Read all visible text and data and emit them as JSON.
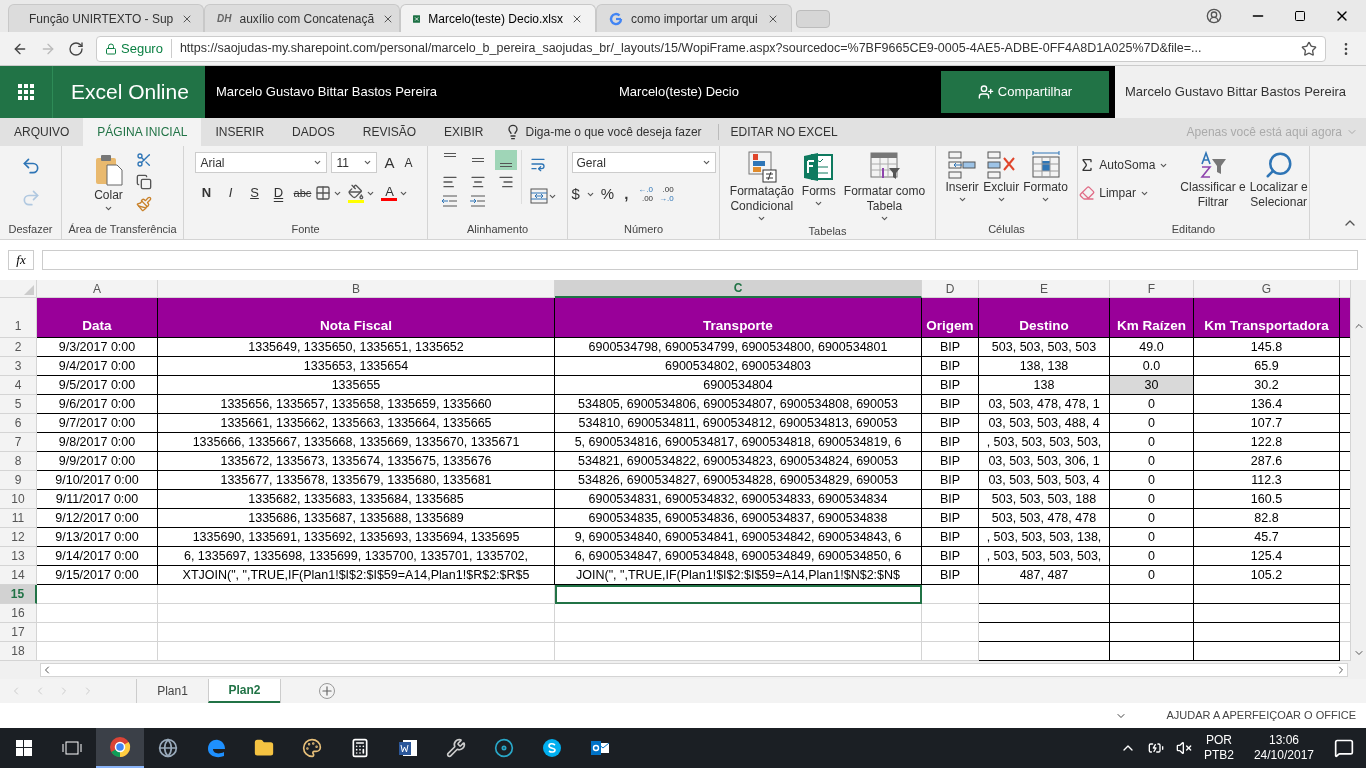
{
  "browser": {
    "tabs": [
      {
        "title": "Função UNIRTEXTO - Sup",
        "kind": "office",
        "selected": false
      },
      {
        "title": "auxílio com Concatenaçã",
        "kind": "dh",
        "icon_text": "DH",
        "selected": false
      },
      {
        "title": "Marcelo(teste) Decio.xlsx",
        "kind": "excel",
        "selected": true
      },
      {
        "title": "como importar um arqui",
        "kind": "google",
        "selected": false
      }
    ],
    "secure_label": "Seguro",
    "url": "https://saojudas-my.sharepoint.com/personal/marcelo_b_pereira_saojudas_br/_layouts/15/WopiFrame.aspx?sourcedoc=%7BF9665CE9-0005-4AE5-ADBE-0FF4A8D1A025%7D&file=..."
  },
  "app_bar": {
    "app_name": "Excel Online",
    "owner": "Marcelo Gustavo Bittar Bastos Pereira",
    "document": "Marcelo(teste) Decio",
    "share": "Compartilhar",
    "user": "Marcelo Gustavo Bittar Bastos Pereira"
  },
  "ribbon_tabs": [
    {
      "label": "ARQUIVO",
      "selected": false
    },
    {
      "label": "PÁGINA INICIAL",
      "selected": true
    },
    {
      "label": "INSERIR",
      "selected": false
    },
    {
      "label": "DADOS",
      "selected": false
    },
    {
      "label": "REVISÃO",
      "selected": false
    },
    {
      "label": "EXIBIR",
      "selected": false
    }
  ],
  "tell_me": "Diga-me o que você deseja fazer",
  "edit_in_excel": "EDITAR NO EXCEL",
  "presence": "Apenas você está aqui agora",
  "ribbon": {
    "undo_label": "Desfazer",
    "clipboard": {
      "paste": "Colar",
      "label": "Área de Transferência"
    },
    "font": {
      "name": "Arial",
      "size": "11",
      "grow": "A",
      "shrink": "A",
      "styles": [
        "N",
        "I",
        "S",
        "D",
        "abc"
      ],
      "color_letter": "A",
      "label": "Fonte"
    },
    "alignment": {
      "vertical": [
        {
          "selected": false
        },
        {
          "selected": false
        },
        {
          "selected": true
        }
      ],
      "label": "Alinhamento"
    },
    "number": {
      "format": "Geral",
      "currency": "$",
      "percent": "%",
      "comma": ",",
      "increase_decimal": {
        "arrow": "←",
        "top": ".0",
        "bottom": ".00"
      },
      "decrease_decimal": {
        "arrow": "→",
        "top": ".00",
        "bottom": ".0"
      },
      "label": "Número"
    },
    "tables": {
      "buttons": [
        {
          "kind": "conditional",
          "lines": [
            "Formatação",
            "Condicional"
          ]
        },
        {
          "kind": "forms",
          "lines": [
            "Forms"
          ]
        },
        {
          "kind": "table",
          "lines": [
            "Formatar como",
            "Tabela"
          ]
        }
      ],
      "label": "Tabelas"
    },
    "cells": {
      "buttons": [
        {
          "kind": "insert",
          "label": "Inserir"
        },
        {
          "kind": "delete",
          "label": "Excluir"
        },
        {
          "kind": "format",
          "label": "Formato"
        }
      ],
      "label": "Células"
    },
    "editing": {
      "autosum": "AutoSoma",
      "clear": "Limpar",
      "sort": [
        "Classificar e",
        "Filtrar"
      ],
      "find": [
        "Localizar e",
        "Selecionar"
      ],
      "label": "Editando"
    }
  },
  "formula_bar": {
    "fx": "fx"
  },
  "sheet": {
    "columns": [
      {
        "letter": "A",
        "selected": false
      },
      {
        "letter": "B",
        "selected": false
      },
      {
        "letter": "C",
        "selected": true
      },
      {
        "letter": "D",
        "selected": false
      },
      {
        "letter": "E",
        "selected": false
      },
      {
        "letter": "F",
        "selected": false
      },
      {
        "letter": "G",
        "selected": false
      }
    ],
    "header_row": {
      "num": "1",
      "cells": [
        "Data",
        "Nota Fiscal",
        "Transporte",
        "Origem",
        "Destino",
        "Km Raízen",
        "Km Transportadora"
      ]
    },
    "rows": [
      {
        "num": "2",
        "f_shaded": false,
        "cells": [
          "9/3/2017 0:00",
          "1335649, 1335650, 1335651, 1335652",
          "6900534798, 6900534799, 6900534800, 6900534801",
          "BIP",
          "503, 503, 503, 503",
          "49.0",
          "145.8"
        ]
      },
      {
        "num": "3",
        "f_shaded": false,
        "cells": [
          "9/4/2017 0:00",
          "1335653, 1335654",
          "6900534802, 6900534803",
          "BIP",
          "138, 138",
          "0.0",
          "65.9"
        ]
      },
      {
        "num": "4",
        "f_shaded": true,
        "cells": [
          "9/5/2017 0:00",
          "1335655",
          "6900534804",
          "BIP",
          "138",
          "30",
          "30.2"
        ]
      },
      {
        "num": "5",
        "f_shaded": false,
        "cells": [
          "9/6/2017 0:00",
          "1335656, 1335657, 1335658, 1335659, 1335660",
          "534805, 6900534806, 6900534807, 6900534808, 690053",
          "BIP",
          "03, 503, 478, 478, 1",
          "0",
          "136.4"
        ]
      },
      {
        "num": "6",
        "f_shaded": false,
        "cells": [
          "9/7/2017 0:00",
          "1335661, 1335662, 1335663, 1335664, 1335665",
          "534810, 6900534811, 6900534812, 6900534813, 690053",
          "BIP",
          "03, 503, 503, 488, 4",
          "0",
          "107.7"
        ]
      },
      {
        "num": "7",
        "f_shaded": false,
        "cells": [
          "9/8/2017 0:00",
          "1335666, 1335667, 1335668, 1335669, 1335670, 1335671",
          "5, 6900534816, 6900534817, 6900534818, 6900534819, 6",
          "BIP",
          ", 503, 503, 503, 503,",
          "0",
          "122.8"
        ]
      },
      {
        "num": "8",
        "f_shaded": false,
        "cells": [
          "9/9/2017 0:00",
          "1335672, 1335673, 1335674, 1335675, 1335676",
          "534821, 6900534822, 6900534823, 6900534824, 690053",
          "BIP",
          "03, 503, 503, 306, 1",
          "0",
          "287.6"
        ]
      },
      {
        "num": "9",
        "f_shaded": false,
        "cells": [
          "9/10/2017 0:00",
          "1335677, 1335678, 1335679, 1335680, 1335681",
          "534826, 6900534827, 6900534828, 6900534829, 690053",
          "BIP",
          "03, 503, 503, 503, 4",
          "0",
          "112.3"
        ]
      },
      {
        "num": "10",
        "f_shaded": false,
        "cells": [
          "9/11/2017 0:00",
          "1335682, 1335683, 1335684, 1335685",
          "6900534831, 6900534832, 6900534833, 6900534834",
          "BIP",
          "503, 503, 503, 188",
          "0",
          "160.5"
        ]
      },
      {
        "num": "11",
        "f_shaded": false,
        "cells": [
          "9/12/2017 0:00",
          "1335686, 1335687, 1335688, 1335689",
          "6900534835, 6900534836, 6900534837, 6900534838",
          "BIP",
          "503, 503, 478, 478",
          "0",
          "82.8"
        ]
      },
      {
        "num": "12",
        "f_shaded": false,
        "cells": [
          "9/13/2017 0:00",
          "1335690, 1335691, 1335692, 1335693, 1335694, 1335695",
          "9, 6900534840, 6900534841, 6900534842, 6900534843, 6",
          "BIP",
          ", 503, 503, 503, 138,",
          "0",
          "45.7"
        ]
      },
      {
        "num": "13",
        "f_shaded": false,
        "cells": [
          "9/14/2017 0:00",
          "6, 1335697, 1335698, 1335699, 1335700, 1335701, 1335702,",
          "6, 6900534847, 6900534848, 6900534849, 6900534850, 6",
          "BIP",
          ", 503, 503, 503, 503,",
          "0",
          "125.4"
        ]
      },
      {
        "num": "14",
        "f_shaded": false,
        "cells": [
          "9/15/2017 0:00",
          "XTJOIN(\", \",TRUE,IF(Plan1!$I$2:$I$59=A14,Plan1!$R$2:$R$5",
          "JOIN(\", \",TRUE,IF(Plan1!$I$2:$I$59=A14,Plan1!$N$2:$N$",
          "BIP",
          "487, 487",
          "0",
          "105.2"
        ]
      }
    ],
    "empty_rows": [
      {
        "num": "15",
        "selected": true
      },
      {
        "num": "16",
        "selected": false
      },
      {
        "num": "17",
        "selected": false
      },
      {
        "num": "18",
        "selected": false
      }
    ]
  },
  "sheet_tabs": [
    {
      "label": "Plan1",
      "selected": false
    },
    {
      "label": "Plan2",
      "selected": true
    }
  ],
  "status_bar": "AJUDAR A APERFEIÇOAR O OFFICE",
  "taskbar": {
    "apps": [
      {
        "kind": "taskview",
        "active": false
      },
      {
        "kind": "chrome",
        "active": true
      },
      {
        "kind": "globe",
        "active": false
      },
      {
        "kind": "edge",
        "active": false
      },
      {
        "kind": "explorer",
        "active": false
      },
      {
        "kind": "paint",
        "active": false
      },
      {
        "kind": "calculator",
        "active": false
      },
      {
        "kind": "word",
        "active": false
      },
      {
        "kind": "tools",
        "active": false
      },
      {
        "kind": "disc",
        "active": false
      },
      {
        "kind": "skype",
        "active": false
      },
      {
        "kind": "outlook",
        "active": false
      }
    ],
    "language": "POR",
    "layout": "PTB2",
    "time": "13:06",
    "date": "24/10/2017"
  }
}
